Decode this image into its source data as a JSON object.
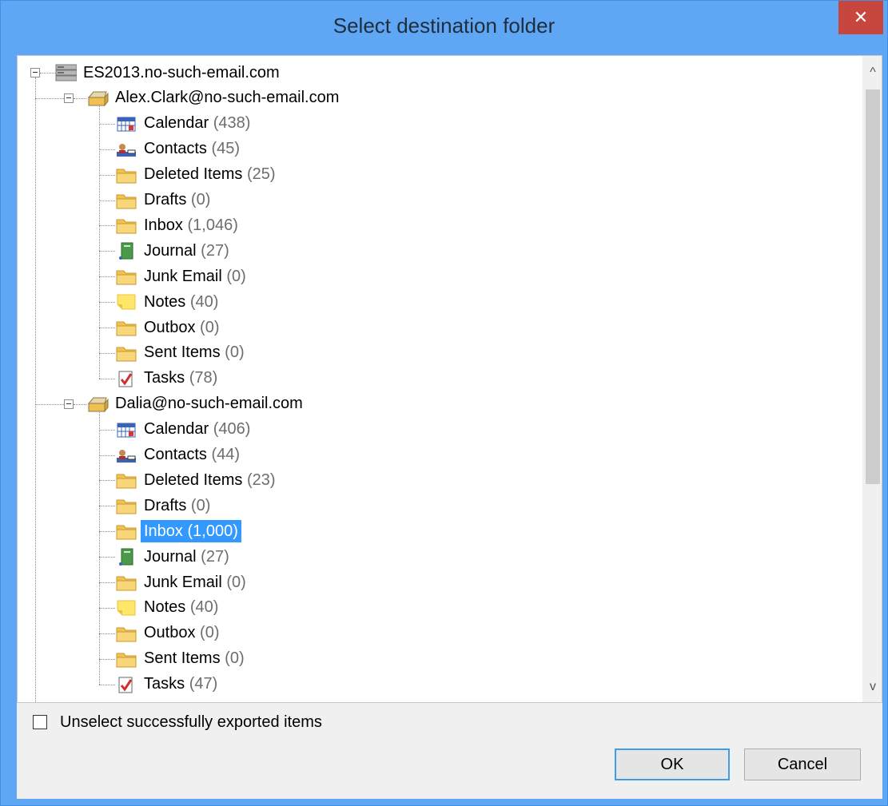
{
  "window": {
    "title": "Select destination folder",
    "close_glyph": "✕"
  },
  "tree": {
    "root": "ES2013.no-such-email.com",
    "mailboxes": [
      {
        "name": "Alex.Clark@no-such-email.com",
        "folders": [
          {
            "name": "Calendar",
            "count": "(438)",
            "icon": "calendar-icon"
          },
          {
            "name": "Contacts",
            "count": "(45)",
            "icon": "contacts-icon"
          },
          {
            "name": "Deleted Items",
            "count": "(25)",
            "icon": "folder-icon"
          },
          {
            "name": "Drafts",
            "count": "(0)",
            "icon": "folder-icon"
          },
          {
            "name": "Inbox",
            "count": "(1,046)",
            "icon": "folder-icon"
          },
          {
            "name": "Journal",
            "count": "(27)",
            "icon": "journal-icon"
          },
          {
            "name": "Junk Email",
            "count": "(0)",
            "icon": "folder-icon"
          },
          {
            "name": "Notes",
            "count": "(40)",
            "icon": "notes-icon"
          },
          {
            "name": "Outbox",
            "count": "(0)",
            "icon": "folder-icon"
          },
          {
            "name": "Sent Items",
            "count": "(0)",
            "icon": "folder-icon"
          },
          {
            "name": "Tasks",
            "count": "(78)",
            "icon": "tasks-icon"
          }
        ]
      },
      {
        "name": "Dalia@no-such-email.com",
        "folders": [
          {
            "name": "Calendar",
            "count": "(406)",
            "icon": "calendar-icon"
          },
          {
            "name": "Contacts",
            "count": "(44)",
            "icon": "contacts-icon"
          },
          {
            "name": "Deleted Items",
            "count": "(23)",
            "icon": "folder-icon"
          },
          {
            "name": "Drafts",
            "count": "(0)",
            "icon": "folder-icon"
          },
          {
            "name": "Inbox",
            "count": "(1,000)",
            "icon": "folder-icon",
            "selected": true
          },
          {
            "name": "Journal",
            "count": "(27)",
            "icon": "journal-icon"
          },
          {
            "name": "Junk Email",
            "count": "(0)",
            "icon": "folder-icon"
          },
          {
            "name": "Notes",
            "count": "(40)",
            "icon": "notes-icon"
          },
          {
            "name": "Outbox",
            "count": "(0)",
            "icon": "folder-icon"
          },
          {
            "name": "Sent Items",
            "count": "(0)",
            "icon": "folder-icon"
          },
          {
            "name": "Tasks",
            "count": "(47)",
            "icon": "tasks-icon"
          }
        ]
      }
    ]
  },
  "scrollbar": {
    "up_glyph": "^",
    "down_glyph": "v"
  },
  "options": {
    "unselect_label": "Unselect successfully exported items",
    "unselect_checked": false
  },
  "buttons": {
    "ok_label": "OK",
    "cancel_label": "Cancel"
  },
  "colors": {
    "titlebar": "#5fa7f5",
    "close": "#c7463d",
    "selection": "#3399ff"
  }
}
